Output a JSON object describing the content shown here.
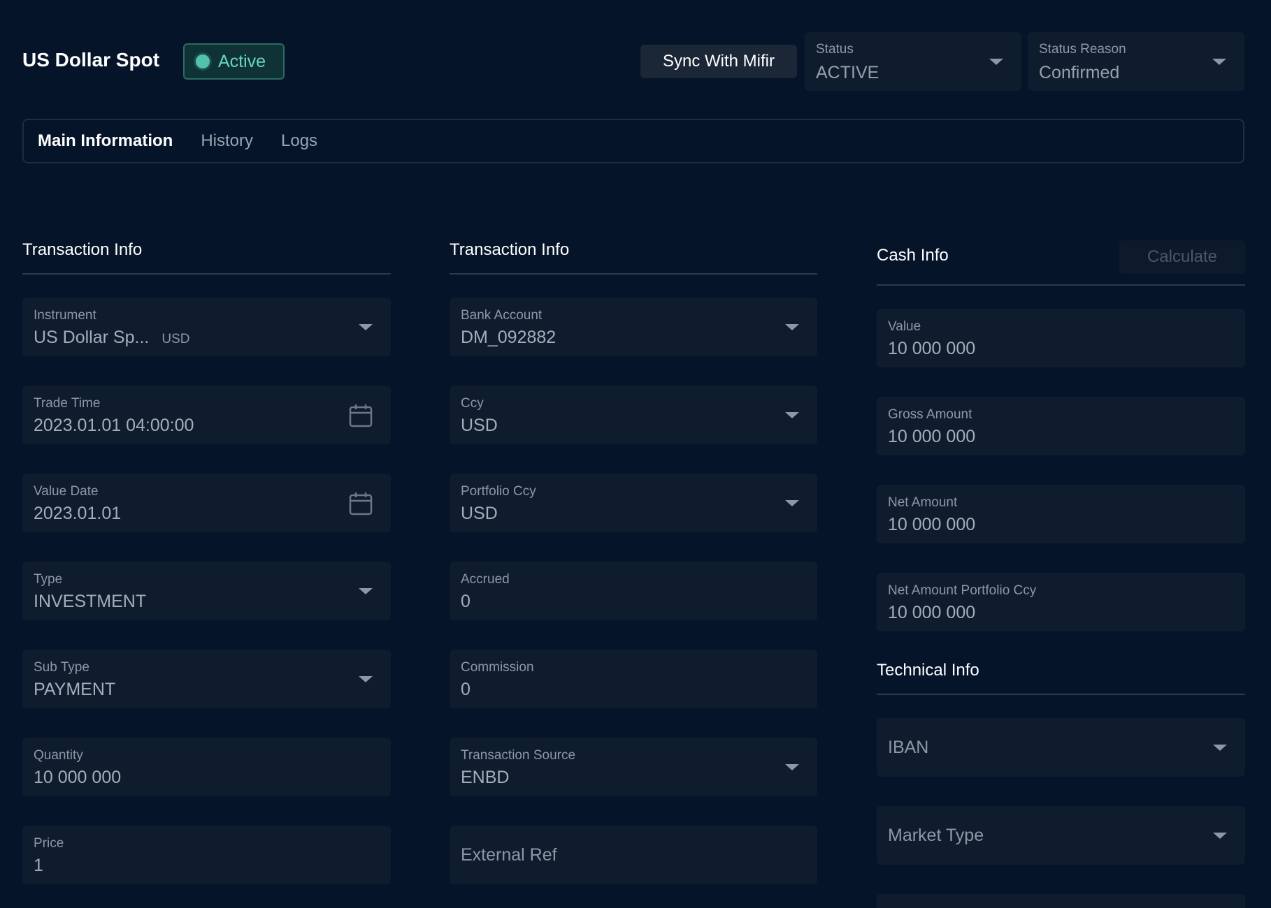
{
  "header": {
    "title": "US Dollar Spot",
    "badge": "Active",
    "sync_label": "Sync With Mifir",
    "status": {
      "label": "Status",
      "value": "ACTIVE"
    },
    "status_reason": {
      "label": "Status Reason",
      "value": "Confirmed"
    }
  },
  "tabs": [
    {
      "label": "Main Information",
      "active": true
    },
    {
      "label": "History",
      "active": false
    },
    {
      "label": "Logs",
      "active": false
    }
  ],
  "col1": {
    "title": "Transaction Info",
    "instrument": {
      "label": "Instrument",
      "value": "US Dollar Sp...",
      "ccy": "USD"
    },
    "trade_time": {
      "label": "Trade Time",
      "value": "2023.01.01 04:00:00"
    },
    "value_date": {
      "label": "Value Date",
      "value": "2023.01.01"
    },
    "type": {
      "label": "Type",
      "value": "INVESTMENT"
    },
    "sub_type": {
      "label": "Sub Type",
      "value": "PAYMENT"
    },
    "quantity": {
      "label": "Quantity",
      "value": "10 000 000"
    },
    "price": {
      "label": "Price",
      "value": "1"
    }
  },
  "col2": {
    "title": "Transaction Info",
    "bank_account": {
      "label": "Bank Account",
      "value": "DM_092882"
    },
    "ccy": {
      "label": "Ccy",
      "value": "USD"
    },
    "portfolio_ccy": {
      "label": "Portfolio Ccy",
      "value": "USD"
    },
    "accrued": {
      "label": "Accrued",
      "value": "0"
    },
    "commission": {
      "label": "Commission",
      "value": "0"
    },
    "transaction_source": {
      "label": "Transaction Source",
      "value": "ENBD"
    },
    "external_ref": {
      "placeholder": "External Ref"
    }
  },
  "col3": {
    "title": "Cash Info",
    "calculate_label": "Calculate",
    "value": {
      "label": "Value",
      "value": "10 000 000"
    },
    "gross_amount": {
      "label": "Gross Amount",
      "value": "10 000 000"
    },
    "net_amount": {
      "label": "Net Amount",
      "value": "10 000 000"
    },
    "net_amount_portfolio": {
      "label": "Net Amount Portfolio Ccy",
      "value": "10 000 000"
    },
    "technical_title": "Technical Info",
    "iban": {
      "placeholder": "IBAN"
    },
    "market_type": {
      "placeholder": "Market Type"
    }
  },
  "colors": {
    "background": "#06142a",
    "field": "#0e1c2d",
    "accent": "#52c2ad"
  }
}
